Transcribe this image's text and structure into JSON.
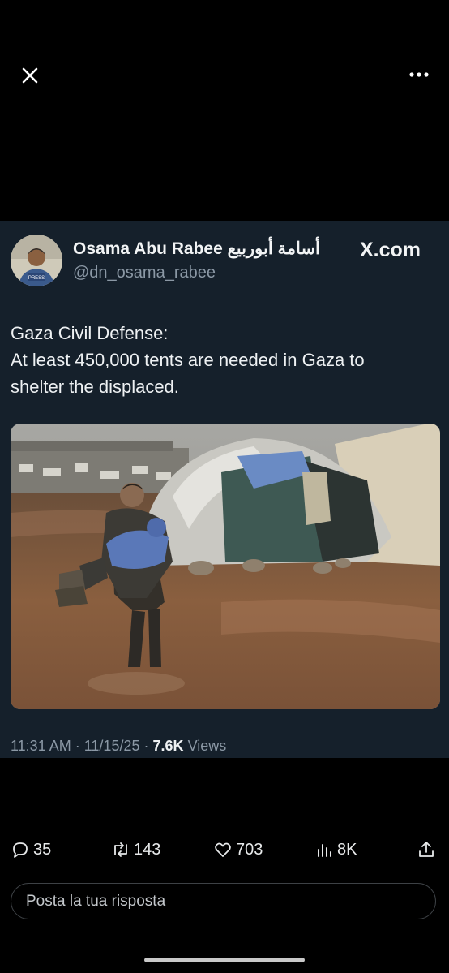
{
  "topbar": {
    "close_icon": "close-icon",
    "more_icon": "more-horizontal-icon"
  },
  "tweet": {
    "author_name": "Osama Abu Rabee أسامة أبوربيع",
    "author_handle": "@dn_osama_rabee",
    "brand": "X.com",
    "text_lines": [
      "Gaza Civil Defense:",
      "At least 450,000 tents are needed in Gaza to",
      "shelter the displaced."
    ],
    "time": "11:31 AM",
    "date": "11/15/25",
    "views_count": "7.6K",
    "views_label": "Views",
    "separator": "·"
  },
  "actions": {
    "replies": "35",
    "reposts": "143",
    "likes": "703",
    "views": "8K"
  },
  "reply": {
    "placeholder": "Posta la tua risposta"
  },
  "colors": {
    "background": "#000000",
    "card": "#15202b",
    "muted": "#8b98a5"
  }
}
